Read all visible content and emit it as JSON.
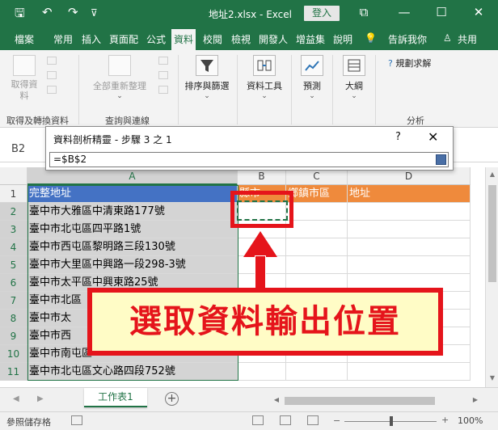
{
  "window": {
    "title": "地址2.xlsx  -  Excel",
    "login": "登入",
    "qa_save": "🖫",
    "qa_undo": "↶",
    "qa_redo": "↷",
    "qa_more": "⊽",
    "icon_ribbon_display": "⧉",
    "min": "—",
    "restore": "☐",
    "close": "✕"
  },
  "tabs": [
    "檔案",
    "常用",
    "插入",
    "頁面配",
    "公式",
    "資料",
    "校閱",
    "檢視",
    "開發人",
    "增益集",
    "說明"
  ],
  "tabs_right": {
    "bulb": "💡",
    "tell": "告訴我你",
    "share_icon": "♙",
    "share": "共用"
  },
  "ribbon": {
    "get_data_btn": "取得資\n料",
    "get_data_group": "取得及轉換資料",
    "refresh_btn": "全部重新整理",
    "queries_group": "查詢與連線",
    "sort_btn": "排序與篩選",
    "tools_btn": "資料工具",
    "forecast_btn": "預測",
    "outline_btn": "大綱",
    "solver_btn": "規劃求解",
    "analysis_group": "分析",
    "chevron": "⌄"
  },
  "formula_bar": {
    "namebox": "B2"
  },
  "dialog": {
    "title": "資料剖析精靈 - 步驟 3 之 1",
    "help": "?",
    "close": "✕",
    "value": "=$B$2"
  },
  "columns": [
    "A",
    "B",
    "C",
    "D"
  ],
  "rows": [
    {
      "num": "1",
      "a": "完整地址",
      "b": "縣市",
      "c": "鄉鎮市區",
      "d": "地址"
    },
    {
      "num": "2",
      "a": "臺中市大雅區中清東路177號",
      "b": "",
      "c": "",
      "d": ""
    },
    {
      "num": "3",
      "a": "臺中市北屯區四平路1號",
      "b": "",
      "c": "",
      "d": ""
    },
    {
      "num": "4",
      "a": "臺中市西屯區黎明路三段130號",
      "b": "",
      "c": "",
      "d": ""
    },
    {
      "num": "5",
      "a": "臺中市大里區中興路一段298-3號",
      "b": "",
      "c": "",
      "d": ""
    },
    {
      "num": "6",
      "a": "臺中市太平區中興東路25號",
      "b": "",
      "c": "",
      "d": ""
    },
    {
      "num": "7",
      "a": "臺中市北區",
      "b": "",
      "c": "",
      "d": ""
    },
    {
      "num": "8",
      "a": "臺中市太",
      "b": "",
      "c": "",
      "d": ""
    },
    {
      "num": "9",
      "a": "臺中市西",
      "b": "",
      "c": "",
      "d": ""
    },
    {
      "num": "10",
      "a": "臺中市南屯區",
      "b": "",
      "c": "",
      "d": ""
    },
    {
      "num": "11",
      "a": "臺中市北屯區文心路四段752號",
      "b": "",
      "c": "",
      "d": ""
    }
  ],
  "callout": "選取資料輸出位置",
  "sheet_tab": "工作表1",
  "add_sheet": "+",
  "status": {
    "text": "參照儲存格",
    "zoom": "100%"
  },
  "colors": {
    "accent": "#217346",
    "annotation": "#e5141b",
    "callout_bg": "#fffcc6"
  }
}
